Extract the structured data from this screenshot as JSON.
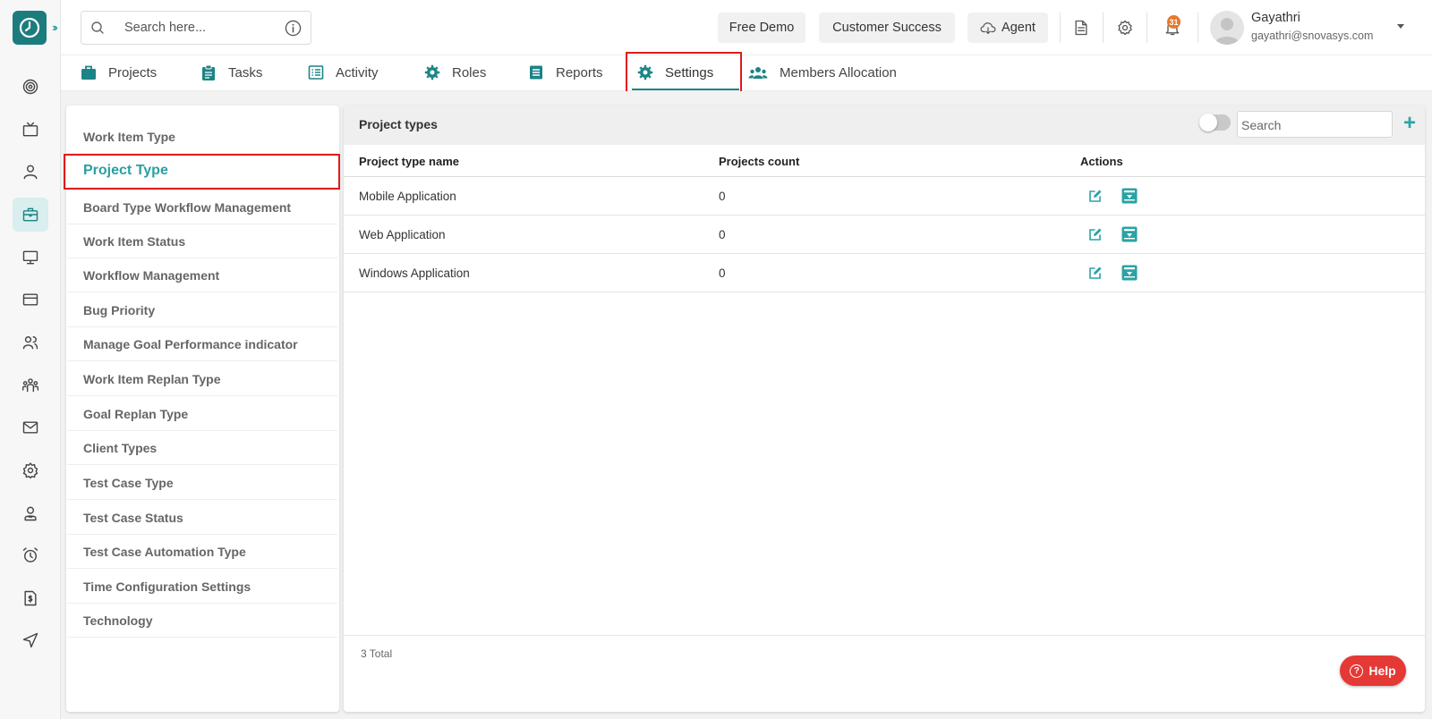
{
  "colors": {
    "accent": "#1c8486",
    "accent_light": "#2aa3a5",
    "highlight_box": "#e01b1b",
    "help_button": "#e53935",
    "notification_badge": "#e5792f"
  },
  "header": {
    "search_placeholder": "Search here...",
    "free_demo": "Free Demo",
    "customer_success": "Customer Success",
    "agent": "Agent",
    "notification_count": "31",
    "user_name": "Gayathri",
    "user_email": "gayathri@snovasys.com"
  },
  "rail_icons": [
    "dashboard-icon",
    "tv-icon",
    "user-icon",
    "briefcase-icon",
    "monitor-icon",
    "credit-card-icon",
    "users-icon",
    "team-icon",
    "mail-icon",
    "settings-icon",
    "person-badge-icon",
    "alarm-icon",
    "invoice-icon",
    "send-icon"
  ],
  "tabs": [
    {
      "label": "Projects",
      "icon": "briefcase-icon"
    },
    {
      "label": "Tasks",
      "icon": "clipboard-icon"
    },
    {
      "label": "Activity",
      "icon": "list-icon"
    },
    {
      "label": "Roles",
      "icon": "gear-icon"
    },
    {
      "label": "Reports",
      "icon": "report-icon"
    },
    {
      "label": "Settings",
      "icon": "settings-icon",
      "active": true
    },
    {
      "label": "Members Allocation",
      "icon": "members-icon"
    }
  ],
  "settings_menu": [
    "Work Item Type",
    "Project Type",
    "Board Type Workflow Management",
    "Work Item Status",
    "Workflow Management",
    "Bug Priority",
    "Manage Goal Performance indicator",
    "Work Item Replan Type",
    "Goal Replan Type",
    "Client Types",
    "Test Case Type",
    "Test Case Status",
    "Test Case Automation Type",
    "Time Configuration Settings",
    "Technology"
  ],
  "active_menu": "Project Type",
  "grid": {
    "title": "Project types",
    "search_placeholder": "Search",
    "add_label": "+",
    "columns": [
      "Project type name",
      "Projects count",
      "Actions"
    ],
    "rows": [
      {
        "name": "Mobile Application",
        "count": "0"
      },
      {
        "name": "Web Application",
        "count": "0"
      },
      {
        "name": "Windows Application",
        "count": "0"
      }
    ],
    "total": "3 Total"
  },
  "help_label": "Help"
}
